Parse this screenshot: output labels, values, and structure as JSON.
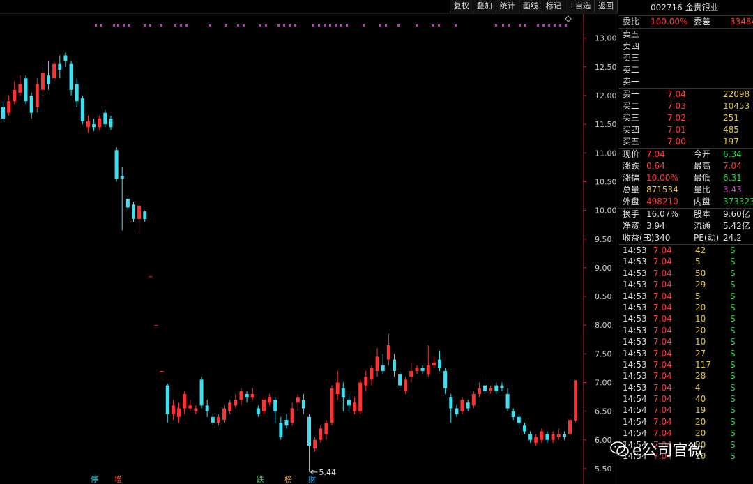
{
  "toolbar": [
    "复权",
    "叠加",
    "统计",
    "画线",
    "标记",
    "+自选",
    "返回"
  ],
  "stock_title": "002716 金贵银业",
  "chart": {
    "y_ticks": [
      "13.00",
      "12.50",
      "12.00",
      "11.50",
      "11.00",
      "10.50",
      "10.00",
      "9.50",
      "9.00",
      "8.50",
      "8.00",
      "7.50",
      "7.00",
      "6.50",
      "6.00",
      "5.50"
    ],
    "low_label": "5.44",
    "markers": [
      {
        "label": "停",
        "color": "#37d7f0"
      },
      {
        "label": "增",
        "color": "#ff5a3a"
      },
      {
        "label": "跌",
        "color": "#2fd052"
      },
      {
        "label": "榜",
        "color": "#e8a040"
      },
      {
        "label": "财",
        "color": "#37b0f0"
      }
    ]
  },
  "colors": {
    "up": "#ff3333",
    "down": "#3ce0f0",
    "dot": "#cc33cc",
    "axis": "#c83030"
  },
  "order": {
    "weibi_label": "委比",
    "weibi_value": "100.00%",
    "weicha_label": "委差",
    "weicha_value": "33484",
    "sell": [
      {
        "label": "卖五"
      },
      {
        "label": "卖四"
      },
      {
        "label": "卖三"
      },
      {
        "label": "卖二"
      },
      {
        "label": "卖一"
      }
    ],
    "buy": [
      {
        "label": "买一",
        "price": "7.04",
        "vol": "22098"
      },
      {
        "label": "买二",
        "price": "7.03",
        "vol": "10453"
      },
      {
        "label": "买三",
        "price": "7.02",
        "vol": "251"
      },
      {
        "label": "买四",
        "price": "7.01",
        "vol": "485"
      },
      {
        "label": "买五",
        "price": "7.00",
        "vol": "197"
      }
    ]
  },
  "quote": [
    {
      "l": "现价",
      "v": "7.04",
      "l2": "今开",
      "v2": "6.34"
    },
    {
      "l": "涨跌",
      "v": "0.64",
      "l2": "最高",
      "v2": "7.04"
    },
    {
      "l": "涨幅",
      "v": "10.00%",
      "l2": "最低",
      "v2": "6.31"
    },
    {
      "l": "总量",
      "v": "871534",
      "l2": "量比",
      "v2": "3.43"
    },
    {
      "l": "外盘",
      "v": "498210",
      "l2": "内盘",
      "v2": "373323"
    }
  ],
  "fin": [
    {
      "l": "换手",
      "v": "16.07%",
      "l2": "股本",
      "v2": "9.60亿"
    },
    {
      "l": "净资",
      "v": "3.94",
      "l2": "流通",
      "v2": "5.42亿"
    },
    {
      "l": "收益(三)",
      "v": "0.340",
      "l2": "PE(动)",
      "v2": "24.2"
    }
  ],
  "ticks": [
    {
      "t": "14:53",
      "p": "7.04",
      "v": "42",
      "s": "S"
    },
    {
      "t": "14:53",
      "p": "7.04",
      "v": "5",
      "s": "S"
    },
    {
      "t": "14:53",
      "p": "7.04",
      "v": "50",
      "s": "S"
    },
    {
      "t": "14:53",
      "p": "7.04",
      "v": "29",
      "s": "S"
    },
    {
      "t": "14:53",
      "p": "7.04",
      "v": "5",
      "s": "S"
    },
    {
      "t": "14:53",
      "p": "7.04",
      "v": "20",
      "s": "S"
    },
    {
      "t": "14:53",
      "p": "7.04",
      "v": "10",
      "s": "S"
    },
    {
      "t": "14:53",
      "p": "7.04",
      "v": "20",
      "s": "S"
    },
    {
      "t": "14:53",
      "p": "7.04",
      "v": "10",
      "s": "S"
    },
    {
      "t": "14:53",
      "p": "7.04",
      "v": "27",
      "s": "S"
    },
    {
      "t": "14:53",
      "p": "7.04",
      "v": "117",
      "s": "S"
    },
    {
      "t": "14:53",
      "p": "7.04",
      "v": "28",
      "s": "S"
    },
    {
      "t": "14:53",
      "p": "7.04",
      "v": "4",
      "s": "S"
    },
    {
      "t": "14:54",
      "p": "7.04",
      "v": "40",
      "s": "S"
    },
    {
      "t": "14:54",
      "p": "7.04",
      "v": "19",
      "s": "S"
    },
    {
      "t": "14:54",
      "p": "7.04",
      "v": "20",
      "s": "S"
    },
    {
      "t": "14:54",
      "p": "7.04",
      "v": "20",
      "s": "S"
    },
    {
      "t": "14:54",
      "p": "7.04",
      "v": "50",
      "s": "S"
    },
    {
      "t": "14:54",
      "p": "7.04",
      "v": "10",
      "s": "S"
    }
  ],
  "watermark": "e公司官微",
  "chart_data": {
    "type": "candlestick",
    "y_axis": {
      "min": 5.44,
      "max": 13.0
    },
    "x_count": 102,
    "candles": [
      [
        11.8,
        11.6,
        11.9,
        11.55
      ],
      [
        11.7,
        11.9,
        12.0,
        11.65
      ],
      [
        11.9,
        12.1,
        12.25,
        11.85
      ],
      [
        12.05,
        12.2,
        12.35,
        12.0
      ],
      [
        12.3,
        11.9,
        12.35,
        11.85
      ],
      [
        12.0,
        11.7,
        12.05,
        11.6
      ],
      [
        11.8,
        12.2,
        12.3,
        11.7
      ],
      [
        12.1,
        12.4,
        12.55,
        12.0
      ],
      [
        12.35,
        12.2,
        12.6,
        12.1
      ],
      [
        12.3,
        12.55,
        12.6,
        12.25
      ],
      [
        12.55,
        12.45,
        12.7,
        12.3
      ],
      [
        12.7,
        12.6,
        12.75,
        12.5
      ],
      [
        12.55,
        12.1,
        12.6,
        12.0
      ],
      [
        12.2,
        11.9,
        12.3,
        11.8
      ],
      [
        11.95,
        11.55,
        12.0,
        11.5
      ],
      [
        11.45,
        11.55,
        11.65,
        11.35
      ],
      [
        11.5,
        11.45,
        11.6,
        11.38
      ],
      [
        11.45,
        11.6,
        11.65,
        11.4
      ],
      [
        11.7,
        11.5,
        11.75,
        11.45
      ],
      [
        11.6,
        11.45,
        11.65,
        11.4
      ],
      [
        11.05,
        10.55,
        11.1,
        10.5
      ],
      [
        10.6,
        10.55,
        10.75,
        9.65
      ],
      [
        10.2,
        10.05,
        10.25,
        10.0
      ],
      [
        10.1,
        9.85,
        10.15,
        9.8
      ],
      [
        9.85,
        10.08,
        10.12,
        9.6
      ],
      [
        9.98,
        9.85,
        10.0,
        9.8
      ],
      [
        8.85,
        8.85,
        8.85,
        8.85
      ],
      [
        8.0,
        8.0,
        8.0,
        8.0
      ],
      [
        7.2,
        7.2,
        7.2,
        7.2
      ],
      [
        6.95,
        6.45,
        6.98,
        6.3
      ],
      [
        6.45,
        6.6,
        6.7,
        6.35
      ],
      [
        6.4,
        6.55,
        6.65,
        6.3
      ],
      [
        6.55,
        6.8,
        6.85,
        6.45
      ],
      [
        6.55,
        6.6,
        6.7,
        6.5
      ],
      [
        6.5,
        6.55,
        6.6,
        6.45
      ],
      [
        7.05,
        6.6,
        7.1,
        6.55
      ],
      [
        6.6,
        6.5,
        6.7,
        6.4
      ],
      [
        6.4,
        6.3,
        6.45,
        6.25
      ],
      [
        6.3,
        6.4,
        6.45,
        6.25
      ],
      [
        6.35,
        6.55,
        6.6,
        6.3
      ],
      [
        6.5,
        6.65,
        6.7,
        6.45
      ],
      [
        6.6,
        6.7,
        6.8,
        6.55
      ],
      [
        6.7,
        6.85,
        6.9,
        6.6
      ],
      [
        6.8,
        6.75,
        6.85,
        6.65
      ],
      [
        6.75,
        6.8,
        6.9,
        6.7
      ],
      [
        6.55,
        6.45,
        6.6,
        6.4
      ],
      [
        6.5,
        6.7,
        6.75,
        6.45
      ],
      [
        6.65,
        6.75,
        6.8,
        6.6
      ],
      [
        6.7,
        6.5,
        6.75,
        6.3
      ],
      [
        6.3,
        6.05,
        6.4,
        6.0
      ],
      [
        6.35,
        6.25,
        6.45,
        6.2
      ],
      [
        6.3,
        6.55,
        6.65,
        6.25
      ],
      [
        6.65,
        6.75,
        6.8,
        6.5
      ],
      [
        6.7,
        6.55,
        6.8,
        6.45
      ],
      [
        6.4,
        5.9,
        6.45,
        5.44
      ],
      [
        5.85,
        6.0,
        6.05,
        5.8
      ],
      [
        6.0,
        6.2,
        6.25,
        5.95
      ],
      [
        6.1,
        6.3,
        6.35,
        6.0
      ],
      [
        6.3,
        6.9,
        6.95,
        6.25
      ],
      [
        6.8,
        7.0,
        7.2,
        6.7
      ],
      [
        6.9,
        6.75,
        7.0,
        6.5
      ],
      [
        6.7,
        6.6,
        6.8,
        6.5
      ],
      [
        6.5,
        6.65,
        6.75,
        6.45
      ],
      [
        6.5,
        7.0,
        7.05,
        6.45
      ],
      [
        6.95,
        7.1,
        7.2,
        6.85
      ],
      [
        7.05,
        7.25,
        7.3,
        6.95
      ],
      [
        7.2,
        7.45,
        7.6,
        7.1
      ],
      [
        7.3,
        7.2,
        7.5,
        7.15
      ],
      [
        7.4,
        7.65,
        7.85,
        7.3
      ],
      [
        7.4,
        7.2,
        7.5,
        7.1
      ],
      [
        7.15,
        6.95,
        7.2,
        6.9
      ],
      [
        6.85,
        7.05,
        7.1,
        6.8
      ],
      [
        7.1,
        7.2,
        7.35,
        7.0
      ],
      [
        7.2,
        7.25,
        7.3,
        7.15
      ],
      [
        7.25,
        7.2,
        7.3,
        7.15
      ],
      [
        7.15,
        7.3,
        7.65,
        7.1
      ],
      [
        7.3,
        7.35,
        7.45,
        7.25
      ],
      [
        7.4,
        7.25,
        7.55,
        7.2
      ],
      [
        7.2,
        6.9,
        7.25,
        6.8
      ],
      [
        6.75,
        6.55,
        6.8,
        6.3
      ],
      [
        6.55,
        6.45,
        6.6,
        6.4
      ],
      [
        6.5,
        6.7,
        6.75,
        6.45
      ],
      [
        6.65,
        6.55,
        6.7,
        6.5
      ],
      [
        6.6,
        6.8,
        6.85,
        6.55
      ],
      [
        6.8,
        6.9,
        7.0,
        6.75
      ],
      [
        6.95,
        6.85,
        7.15,
        6.8
      ],
      [
        6.85,
        6.9,
        6.95,
        6.8
      ],
      [
        6.95,
        6.85,
        7.0,
        6.8
      ],
      [
        6.95,
        6.9,
        7.0,
        6.85
      ],
      [
        6.8,
        6.55,
        6.9,
        6.5
      ],
      [
        6.5,
        6.4,
        6.55,
        6.35
      ],
      [
        6.4,
        6.3,
        6.45,
        6.25
      ],
      [
        6.25,
        6.15,
        6.3,
        6.1
      ],
      [
        6.1,
        6.0,
        6.15,
        5.95
      ],
      [
        5.95,
        6.05,
        6.1,
        5.9
      ],
      [
        6.0,
        6.15,
        6.2,
        5.95
      ],
      [
        6.1,
        6.0,
        6.15,
        5.95
      ],
      [
        6.0,
        6.1,
        6.15,
        5.95
      ],
      [
        6.05,
        6.1,
        6.2,
        6.0
      ],
      [
        6.1,
        6.05,
        6.15,
        6.0
      ],
      [
        6.1,
        6.35,
        6.4,
        6.05
      ],
      [
        6.34,
        7.04,
        7.04,
        6.31
      ]
    ]
  }
}
